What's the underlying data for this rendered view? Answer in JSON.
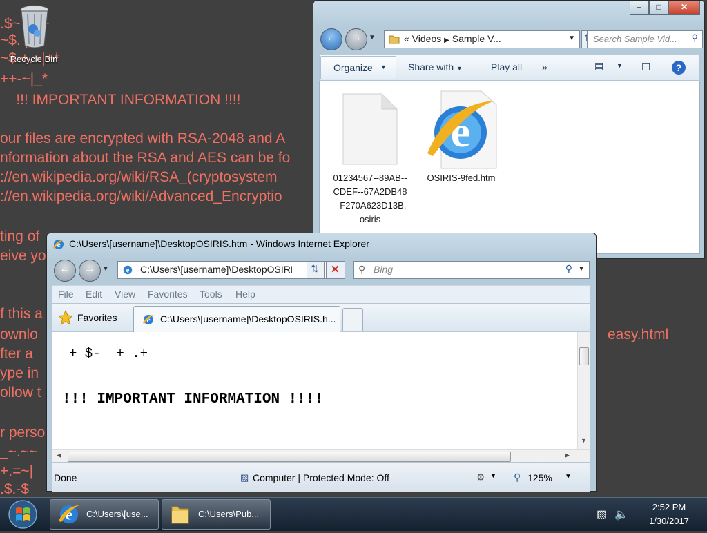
{
  "desktop": {
    "recycle_bin_label": "Recycle Bin",
    "wallpaper_lines": [
      ".$~ _~+",
      "~$. |+*",
      "~$ +.~|+*",
      "++-~|_*",
      "    !!! IMPORTANT INFORMATION !!!!",
      "our files are encrypted with RSA-2048 and A",
      "nformation about the RSA and AES can be fo",
      "://en.wikipedia.org/wiki/RSA_(cryptosystem",
      "://en.wikipedia.org/wiki/Advanced_Encryptio",
      "ting of",
      "eive yo",
      "f this a",
      "ownlo",
      "fter a",
      "ype in",
      "ollow t",
      "r perso",
      "_~.~~",
      "+.=~|",
      ".$.-$"
    ],
    "wallpaper_fragment_right": "easy.html"
  },
  "explorer": {
    "breadcrumb_prefix": "«",
    "breadcrumb": [
      "Videos",
      "Sample V..."
    ],
    "search_placeholder": "Search Sample Vid...",
    "toolbar": {
      "organize": "Organize",
      "share_with": "Share with",
      "play_all": "Play all",
      "more": "»"
    },
    "files": [
      {
        "name": "01234567--89AB--CDEF--67A2DB48--F270A623D13B.osiris",
        "icon": "blank-file-icon"
      },
      {
        "name": "OSIRIS-9fed.htm",
        "icon": "ie-html-file-icon"
      }
    ]
  },
  "ie": {
    "title": "C:\\Users\\[username]\\DesktopOSIRIS.htm - Windows Internet Explorer",
    "address": "C:\\Users\\[username]\\DesktopOSIRIS.htm",
    "search_placeholder": "Bing",
    "menu": [
      "File",
      "Edit",
      "View",
      "Favorites",
      "Tools",
      "Help"
    ],
    "favorites_label": "Favorites",
    "tab_title": "C:\\Users\\[username]\\DesktopOSIRIS.h...",
    "page": {
      "art": "+_$- _+ .+",
      "heading": "!!! IMPORTANT INFORMATION !!!!"
    },
    "status": {
      "done": "Done",
      "zone": "Computer | Protected Mode: Off",
      "zoom": "125%"
    }
  },
  "taskbar": {
    "buttons": [
      {
        "label": "C:\\Users\\[use...",
        "icon": "ie-icon"
      },
      {
        "label": "C:\\Users\\Pub...",
        "icon": "folder-icon"
      }
    ],
    "time": "2:52 PM",
    "date": "1/30/2017"
  },
  "colors": {
    "wallpaper_bg": "#404040",
    "wallpaper_text": "#ee7062"
  }
}
